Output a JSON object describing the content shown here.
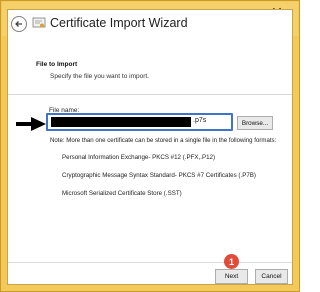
{
  "window": {
    "title": "Certificate Import Wizard",
    "close_glyph": "✕"
  },
  "section": {
    "heading": "File to Import",
    "subheading": "Specify the file you want to import."
  },
  "file": {
    "label": "File name:",
    "value": "",
    "extension_suffix": ".p7s",
    "browse_label": "Browse..."
  },
  "note": "Note:  More than one certificate can be stored in a single file in the following formats:",
  "formats": [
    "Personal Information Exchange- PKCS #12 (.PFX,.P12)",
    "Cryptographic Message Syntax Standard- PKCS #7 Certificates (.P7B)",
    "Microsoft Serialized Certificate Store (.SST)"
  ],
  "annotation": {
    "step_number": "1",
    "badge_color": "#e24a3a",
    "arrow_color": "#000000"
  },
  "buttons": {
    "next": "Next",
    "cancel": "Cancel"
  },
  "colors": {
    "frame": "#f3c95c",
    "input_focus": "#3f74c8"
  }
}
